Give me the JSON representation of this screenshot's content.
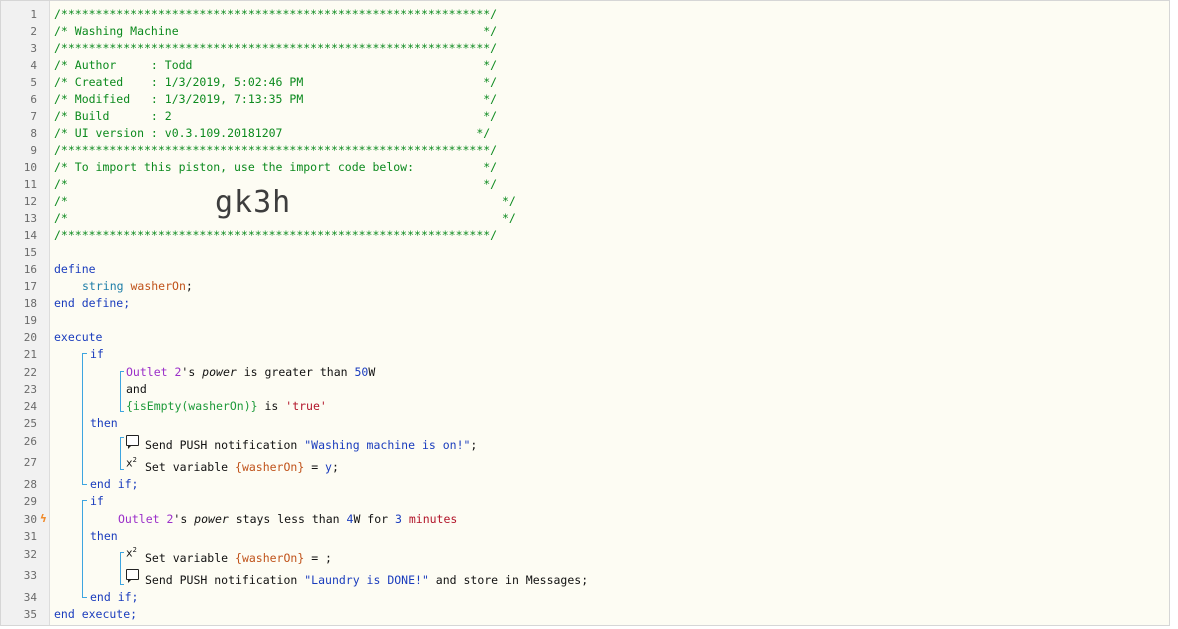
{
  "line_numbers": [
    "1",
    "2",
    "3",
    "4",
    "5",
    "6",
    "7",
    "8",
    "9",
    "10",
    "11",
    "12",
    "13",
    "14",
    "15",
    "16",
    "17",
    "18",
    "19",
    "20",
    "21",
    "22",
    "23",
    "24",
    "25",
    "26",
    "27",
    "28",
    "29",
    "30",
    "31",
    "32",
    "33",
    "34",
    "35"
  ],
  "header": {
    "stars": "/**************************************************************/",
    "title": "/* Washing Machine                                            */",
    "author": "/* Author     : Todd                                          */",
    "created": "/* Created    : 1/3/2019, 5:02:46 PM                          */",
    "modified": "/* Modified   : 1/3/2019, 7:13:35 PM                          */",
    "build": "/* Build      : 2                                             */",
    "ui_version": "/* UI version : v0.3.109.20181207                            */",
    "import_hint": "/* To import this piston, use the import code below:          */",
    "blank_comment": "/*                                                            */",
    "blank_open": "/*",
    "blank_close": "*/",
    "import_code": "gk3h"
  },
  "define": {
    "open": "define",
    "type": "string",
    "var": "washerOn",
    "semi": ";",
    "close": "end define;"
  },
  "execute": {
    "open": "execute",
    "close": "end execute;",
    "if1": {
      "kw_if": "if",
      "cond1_device": "Outlet 2",
      "cond1_poss": "'s ",
      "cond1_attr": "power",
      "cond1_op": " is greater than ",
      "cond1_val": "50",
      "cond1_unit": "W",
      "and": "and",
      "cond2_expr": "{isEmpty(washerOn)}",
      "cond2_op": " is ",
      "cond2_val": "'true'",
      "then": "then",
      "stmt1_pre": "Send PUSH notification ",
      "stmt1_str": "\"Washing machine is on!\"",
      "stmt1_post": ";",
      "stmt2_pre": "Set variable ",
      "stmt2_var": "{washerOn}",
      "stmt2_eq": " = ",
      "stmt2_val": "y",
      "stmt2_post": ";",
      "end": "end if;"
    },
    "if2": {
      "kw_if": "if",
      "cond_device": "Outlet 2",
      "cond_poss": "'s ",
      "cond_attr": "power",
      "cond_op": " stays less than ",
      "cond_val": "4",
      "cond_unit": "W for ",
      "cond_dur": "3",
      "cond_dur_unit": " minutes",
      "then": "then",
      "stmt1_pre": "Set variable ",
      "stmt1_var": "{washerOn}",
      "stmt1_post": " = ;",
      "stmt2_pre": "Send PUSH notification ",
      "stmt2_str": "\"Laundry is DONE!\"",
      "stmt2_post": " and store in Messages;",
      "end": "end if;"
    }
  },
  "icons": {
    "message": "message-icon",
    "set_variable": "set-variable-icon",
    "trigger": "trigger-bolt-icon"
  },
  "colors": {
    "comment": "#0c8a1e",
    "keyword": "#1a3cbd",
    "variable": "#c0531b",
    "device": "#9b2fc9",
    "bracket": "#3da5e0",
    "trigger_mark": "#f08a2a"
  },
  "trigger_mark": "ϟ",
  "x2": {
    "base": "x",
    "exp": "2"
  }
}
